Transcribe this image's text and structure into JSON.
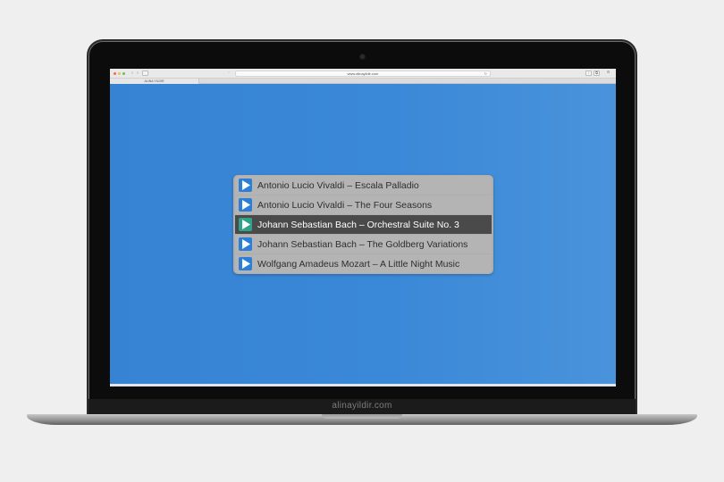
{
  "browser": {
    "url": "www.alinayildir.com",
    "tab_title": "ALINA YILDIR",
    "reload_icon": "reload-icon",
    "nav_back": "‹",
    "nav_forward": "›"
  },
  "laptop": {
    "brand_text": "alinayildir.com"
  },
  "playlist": {
    "active_index": 2,
    "tracks": [
      {
        "title": "Antonio Lucio Vivaldi – Escala Palladio"
      },
      {
        "title": "Antonio Lucio Vivaldi – The Four Seasons"
      },
      {
        "title": "Johann Sebastian Bach – Orchestral Suite No. 3"
      },
      {
        "title": "Johann Sebastian Bach – The Goldberg Variations"
      },
      {
        "title": "Wolfgang Amadeus Mozart – A Little Night Music"
      }
    ]
  },
  "colors": {
    "background": "#3783d3",
    "play_button": "#2b7fd6",
    "play_button_active": "#2fa28a",
    "track_active": "#4a4a4a"
  }
}
